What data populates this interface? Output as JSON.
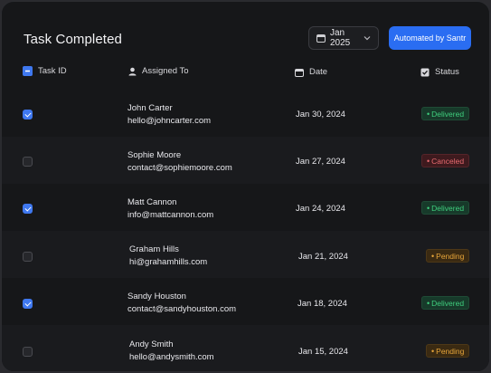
{
  "header": {
    "title": "Task Completed",
    "month_label": "Jan 2025",
    "automate_label": "Automated by Santr"
  },
  "columns": {
    "task_id": "Task ID",
    "assigned_to": "Assigned To",
    "date": "Date",
    "status": "Status"
  },
  "rows": [
    {
      "checked": true,
      "name": "John Carter",
      "email": "hello@johncarter.com",
      "date": "Jan 30, 2024",
      "status": "Delivered"
    },
    {
      "checked": false,
      "name": "Sophie Moore",
      "email": "contact@sophiemoore.com",
      "date": "Jan 27, 2024",
      "status": "Canceled"
    },
    {
      "checked": true,
      "name": "Matt Cannon",
      "email": "info@mattcannon.com",
      "date": "Jan 24, 2024",
      "status": "Delivered"
    },
    {
      "checked": false,
      "name": "Graham Hills",
      "email": "hi@grahamhills.com",
      "date": "Jan 21, 2024",
      "status": "Pending"
    },
    {
      "checked": true,
      "name": "Sandy Houston",
      "email": "contact@sandyhouston.com",
      "date": "Jan 18, 2024",
      "status": "Delivered"
    },
    {
      "checked": false,
      "name": "Andy Smith",
      "email": "hello@andysmith.com",
      "date": "Jan 15, 2024",
      "status": "Pending"
    }
  ],
  "colors": {
    "accent": "#2a6df2",
    "delivered": "#3fcf7e",
    "canceled": "#e86b70",
    "pending": "#e8a63a"
  }
}
